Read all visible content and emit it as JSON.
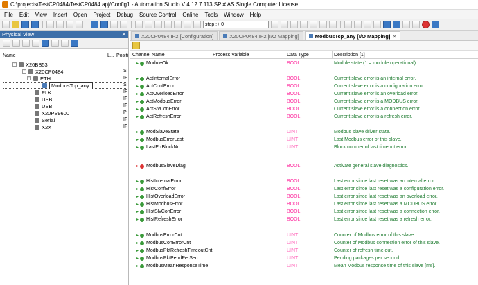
{
  "window": {
    "title": "C:\\projects\\TestCP0484\\TestCP0484.apj/Config1 - Automation Studio V 4.12.7.113 SP # AS Single Computer License"
  },
  "menu": [
    "File",
    "Edit",
    "View",
    "Insert",
    "Open",
    "Project",
    "Debug",
    "Source Control",
    "Online",
    "Tools",
    "Window",
    "Help"
  ],
  "toolbar": {
    "step_text": "step :+ 0"
  },
  "physical_view": {
    "title": "Physical View",
    "pin": "✕",
    "columns": {
      "name": "Name",
      "l": "L...",
      "position": "Positi"
    },
    "tree": [
      {
        "label": "X20BB53",
        "pos": ""
      },
      {
        "label": "X20CP0484",
        "pos": "S"
      },
      {
        "label": "ETH",
        "pos": "IF"
      },
      {
        "label": "ModbusTcp_any",
        "pos": "S"
      },
      {
        "label": "PLK",
        "pos": "IF"
      },
      {
        "label": "USB",
        "pos": "IF"
      },
      {
        "label": "USB",
        "pos": "IF"
      },
      {
        "label": "X20PS9600",
        "pos": "P"
      },
      {
        "label": "Serial",
        "pos": "IF"
      },
      {
        "label": "X2X",
        "pos": "IF"
      }
    ]
  },
  "tabs": [
    {
      "label": "X20CP0484.IF2 [Configuration]",
      "active": false
    },
    {
      "label": "X20CP0484.IF2 [I/O Mapping]",
      "active": false
    },
    {
      "label": "ModbusTcp_any [I/O Mapping]",
      "active": true
    }
  ],
  "grid": {
    "columns": {
      "channel": "Channel Name",
      "pv": "Process Variable",
      "dtype": "Data Type",
      "desc": "Description [1]"
    },
    "rows": [
      {
        "name": "ModuleOk",
        "type": "BOOL",
        "desc": "Module state (1 = module operational)"
      },
      {
        "name": "ActInternalError",
        "type": "BOOL",
        "desc": "Current slave error is an internal error."
      },
      {
        "name": "ActConfError",
        "type": "BOOL",
        "desc": "Current slave error is a configuration error."
      },
      {
        "name": "ActOverloadError",
        "type": "BOOL",
        "desc": "Current slave error is an overload error."
      },
      {
        "name": "ActModbusError",
        "type": "BOOL",
        "desc": "Current slave error is a MODBUS error."
      },
      {
        "name": "ActSlvConError",
        "type": "BOOL",
        "desc": "Current slave error is a connection error."
      },
      {
        "name": "ActRefreshError",
        "type": "BOOL",
        "desc": "Current slave error is a refresh error."
      },
      {
        "name": "ModSlaveState",
        "type": "UINT",
        "desc": "Modbus slave driver state."
      },
      {
        "name": "ModbusErrorLast",
        "type": "UINT",
        "desc": "Last Modbus error of this slave."
      },
      {
        "name": "LastErrBlockNr",
        "type": "UINT",
        "desc": "Block number of last timeout error."
      },
      {
        "name": "ModbusSlaveDiag",
        "type": "BOOL",
        "desc": "Activate general slave diagnostics."
      },
      {
        "name": "HistInternalError",
        "type": "BOOL",
        "desc": "Last error since last reset was an internal error."
      },
      {
        "name": "HistConfError",
        "type": "BOOL",
        "desc": "Last error since last reset was a configuration error."
      },
      {
        "name": "HistOverloadError",
        "type": "BOOL",
        "desc": "Last error since last reset was an overload error."
      },
      {
        "name": "HistModbusError",
        "type": "BOOL",
        "desc": "Last error since last reset was a MODBUS error."
      },
      {
        "name": "HistSlvConError",
        "type": "BOOL",
        "desc": "Last error since last reset was a connection error."
      },
      {
        "name": "HistRefreshError",
        "type": "BOOL",
        "desc": "Last error since last reset was a refresh error."
      },
      {
        "name": "ModbusErrorCnt",
        "type": "UINT",
        "desc": "Counter of Modbus error of this slave."
      },
      {
        "name": "ModbusConErrorCnt",
        "type": "UINT",
        "desc": "Counter of Modbus connection error of this slave."
      },
      {
        "name": "ModbusPktRefreshTimeoutCnt",
        "type": "UINT",
        "desc": "Counter of refresh time out."
      },
      {
        "name": "ModbusPktPendPerSec",
        "type": "UINT",
        "desc": "Pending packages per second."
      },
      {
        "name": "ModbusMeanResponseTime",
        "type": "UINT",
        "desc": "Mean Modbus response time of this slave [ms]."
      }
    ]
  },
  "colors": {
    "bool": "#ff2fa0",
    "desc": "#1c7a2e",
    "input_dot": "#3a9a3a",
    "output_dot": "#dd3333",
    "panel_header": "#3c6ea8"
  }
}
